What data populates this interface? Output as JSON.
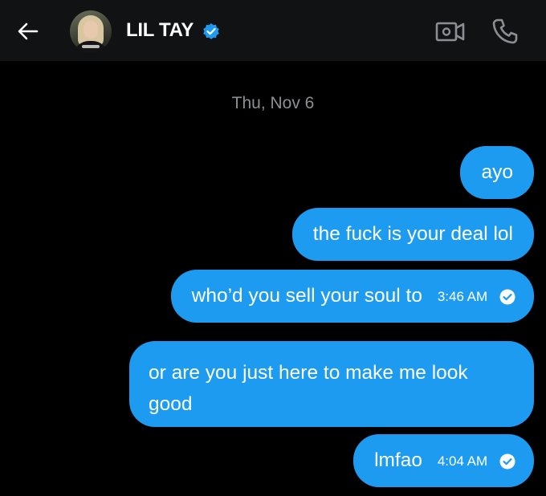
{
  "header": {
    "back_icon": "arrow-left-icon",
    "contact_name": "LIL TAY",
    "verified_icon": "verified-badge-icon",
    "video_call_icon": "video-camera-icon",
    "voice_call_icon": "phone-icon"
  },
  "conversation": {
    "date_separator": "Thu, Nov 6",
    "messages": [
      {
        "text": "ayo"
      },
      {
        "text": "the fuck is your deal lol"
      },
      {
        "text": "who’d you sell your soul to",
        "time": "3:46 AM",
        "status_icon": "read-check-icon"
      },
      {
        "text": "or are you just here to make me look good"
      },
      {
        "text": "lmfao",
        "time": "4:04 AM",
        "status_icon": "read-check-icon"
      }
    ]
  },
  "colors": {
    "bubble": "#1d9bf0",
    "header_bg": "#111214",
    "background": "#000000",
    "date_text": "#8b8f94"
  }
}
